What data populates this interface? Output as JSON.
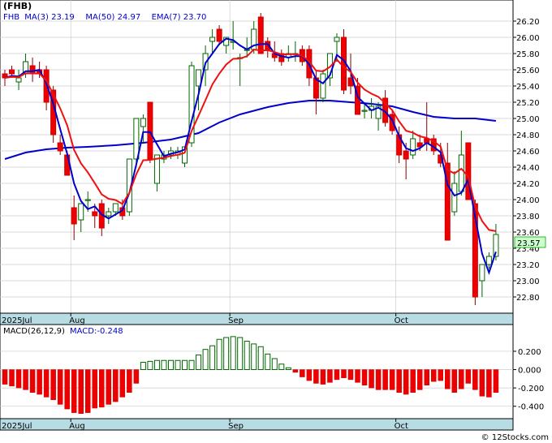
{
  "chart_data": [
    {
      "type": "candlestick",
      "title": "(FHB)",
      "legend": [
        {
          "label": "FHB",
          "value": "",
          "color": "#000000"
        },
        {
          "label": "MA(3)",
          "value": "23.19",
          "color": "#ff0000"
        },
        {
          "label": "MA(50)",
          "value": "24.97",
          "color": "#0000cc"
        },
        {
          "label": "EMA(7)",
          "value": "23.70",
          "color": "#ff0000"
        }
      ],
      "last_price_label": "23.57",
      "ylim": [
        22.6,
        26.4
      ],
      "yticks": [
        "26.20",
        "26.00",
        "25.80",
        "25.60",
        "25.40",
        "25.20",
        "25.00",
        "24.80",
        "24.60",
        "24.40",
        "24.20",
        "24.00",
        "23.80",
        "23.60",
        "23.40",
        "23.20",
        "23.00",
        "22.80"
      ],
      "date_labels": [
        {
          "label": "2025Jul",
          "index": 0
        },
        {
          "label": "Aug",
          "index": 10
        },
        {
          "label": "Sep",
          "index": 33
        },
        {
          "label": "Oct",
          "index": 57
        }
      ],
      "candles": [
        [
          25.55,
          25.6,
          25.4,
          25.5
        ],
        [
          25.6,
          25.65,
          25.5,
          25.55
        ],
        [
          25.45,
          25.6,
          25.35,
          25.5
        ],
        [
          25.55,
          25.8,
          25.5,
          25.7
        ],
        [
          25.65,
          25.75,
          25.45,
          25.55
        ],
        [
          25.6,
          25.7,
          25.5,
          25.55
        ],
        [
          25.6,
          25.65,
          25.1,
          25.2
        ],
        [
          25.35,
          25.4,
          24.7,
          24.8
        ],
        [
          24.7,
          24.8,
          24.55,
          24.6
        ],
        [
          24.55,
          24.6,
          24.3,
          24.3
        ],
        [
          23.9,
          24.05,
          23.5,
          23.7
        ],
        [
          23.75,
          23.95,
          23.6,
          23.95
        ],
        [
          24.0,
          24.1,
          23.85,
          24.0
        ],
        [
          23.85,
          23.95,
          23.65,
          23.8
        ],
        [
          23.95,
          24.0,
          23.55,
          23.65
        ],
        [
          23.8,
          23.9,
          23.7,
          23.85
        ],
        [
          23.85,
          23.95,
          23.8,
          23.95
        ],
        [
          23.9,
          24.0,
          23.75,
          23.8
        ],
        [
          23.85,
          24.5,
          23.8,
          24.5
        ],
        [
          24.5,
          25.0,
          24.4,
          25.0
        ],
        [
          24.9,
          25.05,
          24.7,
          25.0
        ],
        [
          25.2,
          25.2,
          24.45,
          24.5
        ],
        [
          24.2,
          24.55,
          24.1,
          24.55
        ],
        [
          24.5,
          24.6,
          24.45,
          24.55
        ],
        [
          24.55,
          24.65,
          24.5,
          24.6
        ],
        [
          24.55,
          24.65,
          24.5,
          24.6
        ],
        [
          24.45,
          24.65,
          24.4,
          24.65
        ],
        [
          24.7,
          25.7,
          24.65,
          25.65
        ],
        [
          25.4,
          25.6,
          25.1,
          25.6
        ],
        [
          25.6,
          25.9,
          25.4,
          25.8
        ],
        [
          25.95,
          26.1,
          25.8,
          26.0
        ],
        [
          26.1,
          26.15,
          25.9,
          25.95
        ],
        [
          25.9,
          26.0,
          25.8,
          26.0
        ],
        [
          25.95,
          26.2,
          25.85,
          25.95
        ],
        [
          25.75,
          25.8,
          25.4,
          25.75
        ],
        [
          25.85,
          26.0,
          25.75,
          25.85
        ],
        [
          25.85,
          26.2,
          25.8,
          26.1
        ],
        [
          26.25,
          26.3,
          25.8,
          25.8
        ],
        [
          25.95,
          26.0,
          25.75,
          25.85
        ],
        [
          25.8,
          25.95,
          25.7,
          25.75
        ],
        [
          25.8,
          25.85,
          25.65,
          25.7
        ],
        [
          25.75,
          25.9,
          25.7,
          25.8
        ],
        [
          25.8,
          25.95,
          25.7,
          25.8
        ],
        [
          25.85,
          25.9,
          25.65,
          25.7
        ],
        [
          25.85,
          25.9,
          25.4,
          25.5
        ],
        [
          25.5,
          25.6,
          25.05,
          25.25
        ],
        [
          25.25,
          25.6,
          25.2,
          25.55
        ],
        [
          25.5,
          25.8,
          25.4,
          25.8
        ],
        [
          25.95,
          26.05,
          25.7,
          26.0
        ],
        [
          26.0,
          26.1,
          25.3,
          25.35
        ],
        [
          25.5,
          25.8,
          25.3,
          25.4
        ],
        [
          25.4,
          25.5,
          25.05,
          25.05
        ],
        [
          25.1,
          25.2,
          25.0,
          25.1
        ],
        [
          25.1,
          25.25,
          25.0,
          25.15
        ],
        [
          25.0,
          25.2,
          24.85,
          25.15
        ],
        [
          25.25,
          25.35,
          24.9,
          24.95
        ],
        [
          25.05,
          25.1,
          24.8,
          24.85
        ],
        [
          24.8,
          24.9,
          24.45,
          24.55
        ],
        [
          24.6,
          24.7,
          24.25,
          24.5
        ],
        [
          24.55,
          24.85,
          24.5,
          24.75
        ],
        [
          24.7,
          24.8,
          24.6,
          24.65
        ],
        [
          24.75,
          25.2,
          24.6,
          24.7
        ],
        [
          24.75,
          24.8,
          24.55,
          24.6
        ],
        [
          24.55,
          24.7,
          24.4,
          24.45
        ],
        [
          24.45,
          24.7,
          23.5,
          23.5
        ],
        [
          23.85,
          24.35,
          23.8,
          24.2
        ],
        [
          24.1,
          24.85,
          24.05,
          24.55
        ],
        [
          24.7,
          24.7,
          24.0,
          24.0
        ],
        [
          23.95,
          24.0,
          22.7,
          22.8
        ],
        [
          23.0,
          23.2,
          22.8,
          23.2
        ],
        [
          23.2,
          23.35,
          23.15,
          23.3
        ],
        [
          23.3,
          23.7,
          23.25,
          23.57
        ]
      ],
      "ma50": [
        [
          0,
          24.5
        ],
        [
          3,
          24.58
        ],
        [
          6,
          24.62
        ],
        [
          9,
          24.64
        ],
        [
          12,
          24.65
        ],
        [
          16,
          24.67
        ],
        [
          20,
          24.7
        ],
        [
          24,
          24.74
        ],
        [
          28,
          24.82
        ],
        [
          31,
          24.95
        ],
        [
          34,
          25.05
        ],
        [
          38,
          25.14
        ],
        [
          41,
          25.19
        ],
        [
          44,
          25.22
        ],
        [
          47,
          25.22
        ],
        [
          50,
          25.2
        ],
        [
          53,
          25.18
        ],
        [
          56,
          25.15
        ],
        [
          59,
          25.08
        ],
        [
          62,
          25.02
        ],
        [
          65,
          25.0
        ],
        [
          68,
          25.0
        ],
        [
          71,
          24.97
        ]
      ],
      "macd": {
        "label": "MACD(26,12,9)",
        "value_label": "MACD:-0.248",
        "ylim": [
          -0.5,
          0.35
        ],
        "yticks": [
          "0.200",
          "0.000",
          "-0.200",
          "-0.400"
        ],
        "values": [
          -0.16,
          -0.18,
          -0.2,
          -0.22,
          -0.25,
          -0.27,
          -0.3,
          -0.33,
          -0.38,
          -0.43,
          -0.47,
          -0.48,
          -0.47,
          -0.42,
          -0.41,
          -0.38,
          -0.35,
          -0.3,
          -0.25,
          -0.15,
          0.08,
          0.09,
          0.1,
          0.1,
          0.1,
          0.1,
          0.1,
          0.1,
          0.16,
          0.22,
          0.26,
          0.33,
          0.35,
          0.36,
          0.35,
          0.31,
          0.28,
          0.25,
          0.17,
          0.12,
          0.06,
          0.02,
          -0.03,
          -0.08,
          -0.12,
          -0.15,
          -0.16,
          -0.14,
          -0.11,
          -0.09,
          -0.11,
          -0.14,
          -0.17,
          -0.2,
          -0.22,
          -0.22,
          -0.22,
          -0.25,
          -0.27,
          -0.25,
          -0.22,
          -0.17,
          -0.13,
          -0.12,
          -0.21,
          -0.25,
          -0.21,
          -0.15,
          -0.22,
          -0.29,
          -0.3,
          -0.25
        ]
      }
    }
  ],
  "footer": {
    "copyright": "© 12Stocks.com"
  }
}
